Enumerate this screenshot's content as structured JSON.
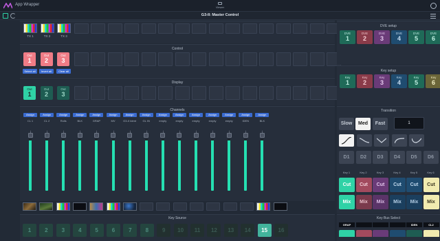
{
  "app": {
    "title": "App Wrapper"
  },
  "viewer": {
    "label": "Viewer"
  },
  "page": {
    "title": "G3-II: Master Control"
  },
  "sources": {
    "items": [
      {
        "label": "TX 1",
        "thumb": "bars"
      },
      {
        "label": "TX 2",
        "thumb": "bars"
      },
      {
        "label": "TX 3",
        "thumb": "bars"
      }
    ]
  },
  "control": {
    "title": "Control",
    "buttons": [
      {
        "label": "Out",
        "num": "1"
      },
      {
        "label": "Out",
        "num": "2"
      },
      {
        "label": "Out",
        "num": "3"
      }
    ],
    "select_all": "Select all",
    "invert_all": "Invert all",
    "clear_all": "Clear all"
  },
  "display": {
    "title": "Display",
    "buttons": [
      {
        "label": "Out",
        "num": "1"
      },
      {
        "label": "Out",
        "num": "2"
      },
      {
        "label": "Out",
        "num": "3"
      }
    ]
  },
  "channels": {
    "title": "Channels",
    "assign_label": "Assign",
    "items": [
      {
        "label": "CL 1",
        "level": 0.97
      },
      {
        "label": "CL 2",
        "level": 0.97
      },
      {
        "label": "Rolls",
        "level": 0.97
      },
      {
        "label": "BLK",
        "level": 0.97
      },
      {
        "label": "GRAP",
        "level": 0.97
      },
      {
        "label": "MV",
        "level": 0.97
      },
      {
        "label": "G3-II Ident",
        "level": 0.97
      },
      {
        "label": "GL IN",
        "level": 0.97
      },
      {
        "label": "empty",
        "level": 0.97
      },
      {
        "label": "empty",
        "level": 0.97
      },
      {
        "label": "empty",
        "level": 0.97
      },
      {
        "label": "empty",
        "level": 0.97
      },
      {
        "label": "empty",
        "level": 0.97
      },
      {
        "label": "IDEN",
        "level": 0.97
      },
      {
        "label": "BLK",
        "level": 0.97
      }
    ]
  },
  "keysource": {
    "title": "Key Source",
    "buttons": [
      "1",
      "2",
      "3",
      "4",
      "5",
      "6",
      "7",
      "8",
      "9",
      "10",
      "11",
      "12",
      "13",
      "14",
      "15",
      "16"
    ]
  },
  "dve": {
    "title": "DVE setup",
    "label": "DVE",
    "nums": [
      "1",
      "2",
      "3",
      "4",
      "5",
      "6"
    ]
  },
  "keysetup": {
    "title": "Key setup",
    "label": "Key",
    "nums": [
      "1",
      "2",
      "3",
      "4",
      "5",
      "6"
    ]
  },
  "transition": {
    "title": "Transition",
    "speeds": [
      "Slow",
      "Med",
      "Fast"
    ],
    "rate": "1",
    "d_buttons": [
      "D1",
      "D2",
      "D3",
      "D4",
      "D5",
      "D6"
    ],
    "key_labels": [
      "Key 1",
      "Key 2",
      "Key 3",
      "Key 4",
      "Key 5",
      "Key 6"
    ],
    "cut_label": "Cut",
    "mix_label": "Mix"
  },
  "keybus": {
    "title": "Key Bus Select",
    "labels": [
      "GRAP",
      "",
      "",
      "",
      "IDEN",
      "CL2"
    ]
  },
  "colors": {
    "accent": "#2fd2a6",
    "assign": "#3a6bd1",
    "pink": "#f07c86"
  }
}
